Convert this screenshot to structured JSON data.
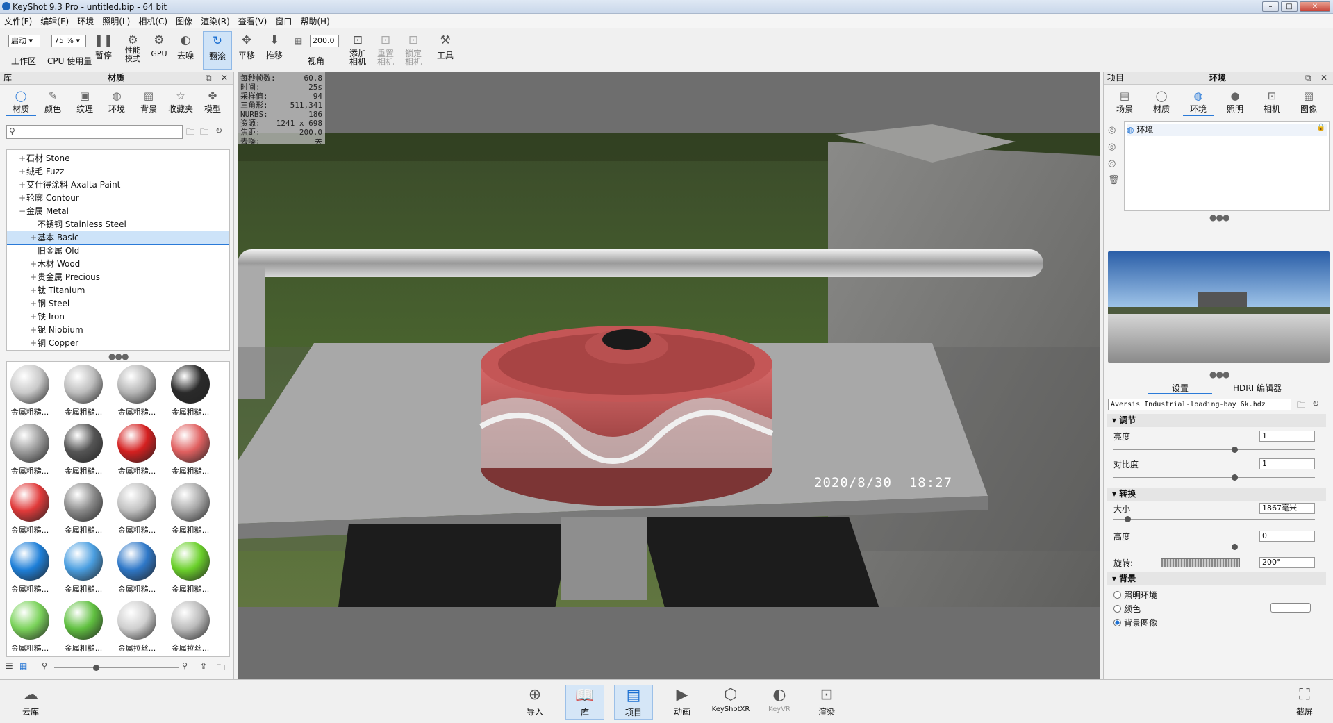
{
  "window": {
    "title": "KeyShot 9.3 Pro  -  untitled.bip  - 64 bit"
  },
  "menu": [
    "文件(F)",
    "编辑(E)",
    "环境",
    "照明(L)",
    "相机(C)",
    "图像",
    "渲染(R)",
    "查看(V)",
    "窗口",
    "帮助(H)"
  ],
  "toolbar": {
    "startup_value": "启动",
    "workspace_label": "工作区",
    "cpu_value": "75 %",
    "cpu_label": "CPU 使用量",
    "pause_label": "暂停",
    "perf_label": "性能\n模式",
    "gpu_label": "GPU",
    "denoise_label": "去噪",
    "tumble_label": "翻滚",
    "pan_label": "平移",
    "dolly_label": "推移",
    "fov_value": "200.0",
    "fov_label": "视角",
    "add_camera_label": "添加\n相机",
    "reset_camera_label": "重置\n相机",
    "lock_camera_label": "锁定\n相机",
    "tools_label": "工具"
  },
  "library": {
    "header_left": "库",
    "header_title": "材质",
    "tabs": [
      "材质",
      "颜色",
      "纹理",
      "环境",
      "背景",
      "收藏夹",
      "模型"
    ],
    "search_placeholder": "",
    "tree": [
      {
        "label": "石材 Stone",
        "indent": 1,
        "pm": "+"
      },
      {
        "label": "绒毛 Fuzz",
        "indent": 1,
        "pm": "+"
      },
      {
        "label": "艾仕得涂料 Axalta Paint",
        "indent": 1,
        "pm": "+"
      },
      {
        "label": "轮廓 Contour",
        "indent": 1,
        "pm": "+"
      },
      {
        "label": "金属 Metal",
        "indent": 1,
        "pm": "−"
      },
      {
        "label": "不锈钢 Stainless Steel",
        "indent": 2,
        "pm": ""
      },
      {
        "label": "基本 Basic",
        "indent": 2,
        "pm": "+",
        "selected": true
      },
      {
        "label": "旧金属 Old",
        "indent": 2,
        "pm": ""
      },
      {
        "label": "木材 Wood",
        "indent": 2,
        "pm": "+"
      },
      {
        "label": "贵金属 Precious",
        "indent": 2,
        "pm": "+"
      },
      {
        "label": "钛 Titanium",
        "indent": 2,
        "pm": "+"
      },
      {
        "label": "钢 Steel",
        "indent": 2,
        "pm": "+"
      },
      {
        "label": "铁 Iron",
        "indent": 2,
        "pm": "+"
      },
      {
        "label": "铌 Niobium",
        "indent": 2,
        "pm": "+"
      },
      {
        "label": "铜 Copper",
        "indent": 2,
        "pm": "+"
      }
    ],
    "thumbs": [
      {
        "label": "金属粗糙...",
        "color": "#c9c9c9"
      },
      {
        "label": "金属粗糙...",
        "color": "#bdbdbd"
      },
      {
        "label": "金属粗糙...",
        "color": "#b5b5b5"
      },
      {
        "label": "金属粗糙...",
        "color": "#2a2a2a"
      },
      {
        "label": "金属粗糙...",
        "color": "#9a9a9a"
      },
      {
        "label": "金属粗糙...",
        "color": "#555555"
      },
      {
        "label": "金属粗糙...",
        "color": "#d42020"
      },
      {
        "label": "金属粗糙...",
        "color": "#e06060"
      },
      {
        "label": "金属粗糙...",
        "color": "#e03a3a"
      },
      {
        "label": "金属粗糙...",
        "color": "#8a8a8a"
      },
      {
        "label": "金属粗糙...",
        "color": "#c0c0c0"
      },
      {
        "label": "金属粗糙...",
        "color": "#a8a8a8"
      },
      {
        "label": "金属粗糙...",
        "color": "#1e7fd8"
      },
      {
        "label": "金属粗糙...",
        "color": "#4a9ee0"
      },
      {
        "label": "金属粗糙...",
        "color": "#2f78c8"
      },
      {
        "label": "金属粗糙...",
        "color": "#6ad02a"
      },
      {
        "label": "金属粗糙...",
        "color": "#7ad25a"
      },
      {
        "label": "金属粗糙...",
        "color": "#60c040"
      },
      {
        "label": "金属拉丝...",
        "color": "#cfcfcf"
      },
      {
        "label": "金属拉丝...",
        "color": "#bbbbbb"
      }
    ]
  },
  "viewport": {
    "stats": [
      {
        "k": "每秒帧数:",
        "v": "60.8"
      },
      {
        "k": "时间:",
        "v": "25s"
      },
      {
        "k": "采样值:",
        "v": "94"
      },
      {
        "k": "三角形:",
        "v": "511,341"
      },
      {
        "k": "NURBS:",
        "v": "186"
      },
      {
        "k": "资源:",
        "v": "1241 x 698"
      },
      {
        "k": "焦距:",
        "v": "200.0"
      },
      {
        "k": "去噪:",
        "v": "关"
      }
    ],
    "timestamp": "2020/8/30  18:27"
  },
  "project": {
    "header_left": "项目",
    "header_title": "环境",
    "tabs": [
      "场景",
      "材质",
      "环境",
      "照明",
      "相机",
      "图像"
    ],
    "env_item": "环境",
    "subtabs": [
      "设置",
      "HDRI 编辑器"
    ],
    "hdri_file": "Aversis_Industrial-loading-bay_6k.hdz",
    "sections": {
      "adjust": "调节",
      "transform": "转换",
      "background": "背景"
    },
    "brightness_label": "亮度",
    "brightness_value": "1",
    "brightness_level": 0.6,
    "contrast_label": "对比度",
    "contrast_value": "1",
    "contrast_level": 0.6,
    "size_label": "大小",
    "size_value": "1867毫米",
    "size_level": 0.07,
    "height_label": "高度",
    "height_value": "0",
    "height_level": 0.6,
    "rotation_label": "旋转:",
    "rotation_value": "200°",
    "bg_options": [
      "照明环境",
      "颜色",
      "背景图像"
    ],
    "bg_selected": 2
  },
  "bottom": {
    "cloud_label": "云库",
    "screenshot_label": "截屏",
    "tabs": [
      "导入",
      "库",
      "项目",
      "动画",
      "KeyShotXR",
      "KeyVR",
      "渲染"
    ]
  }
}
